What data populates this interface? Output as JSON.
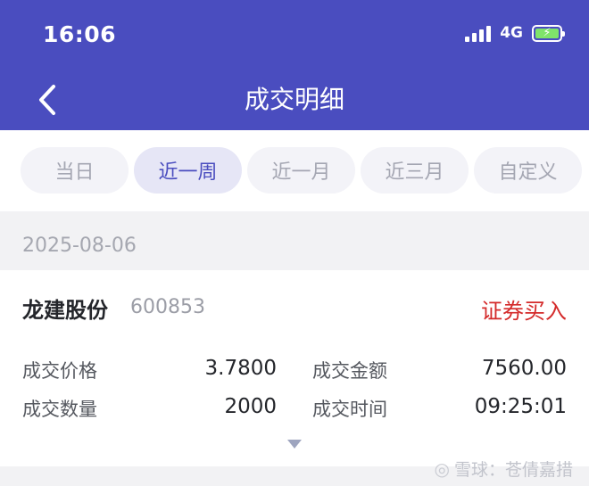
{
  "status_bar": {
    "time": "16:06",
    "network": "4G"
  },
  "nav": {
    "title": "成交明细"
  },
  "tabs": [
    {
      "label": "当日",
      "active": false
    },
    {
      "label": "近一周",
      "active": true
    },
    {
      "label": "近一月",
      "active": false
    },
    {
      "label": "近三月",
      "active": false
    },
    {
      "label": "自定义",
      "active": false
    }
  ],
  "trade": {
    "date": "2025-08-06",
    "stock_name": "龙建股份",
    "stock_code": "600853",
    "type": "证券买入",
    "price_label": "成交价格",
    "price": "3.7800",
    "amount_label": "成交金额",
    "amount": "7560.00",
    "quantity_label": "成交数量",
    "quantity": "2000",
    "time_label": "成交时间",
    "time": "09:25:01"
  },
  "watermark": {
    "text": "雪球：苍倩嘉措"
  },
  "colors": {
    "header": "#4a4dbf",
    "accent": "#4a4dbf",
    "buy": "#d42a2a",
    "battery": "#7fe36a"
  }
}
